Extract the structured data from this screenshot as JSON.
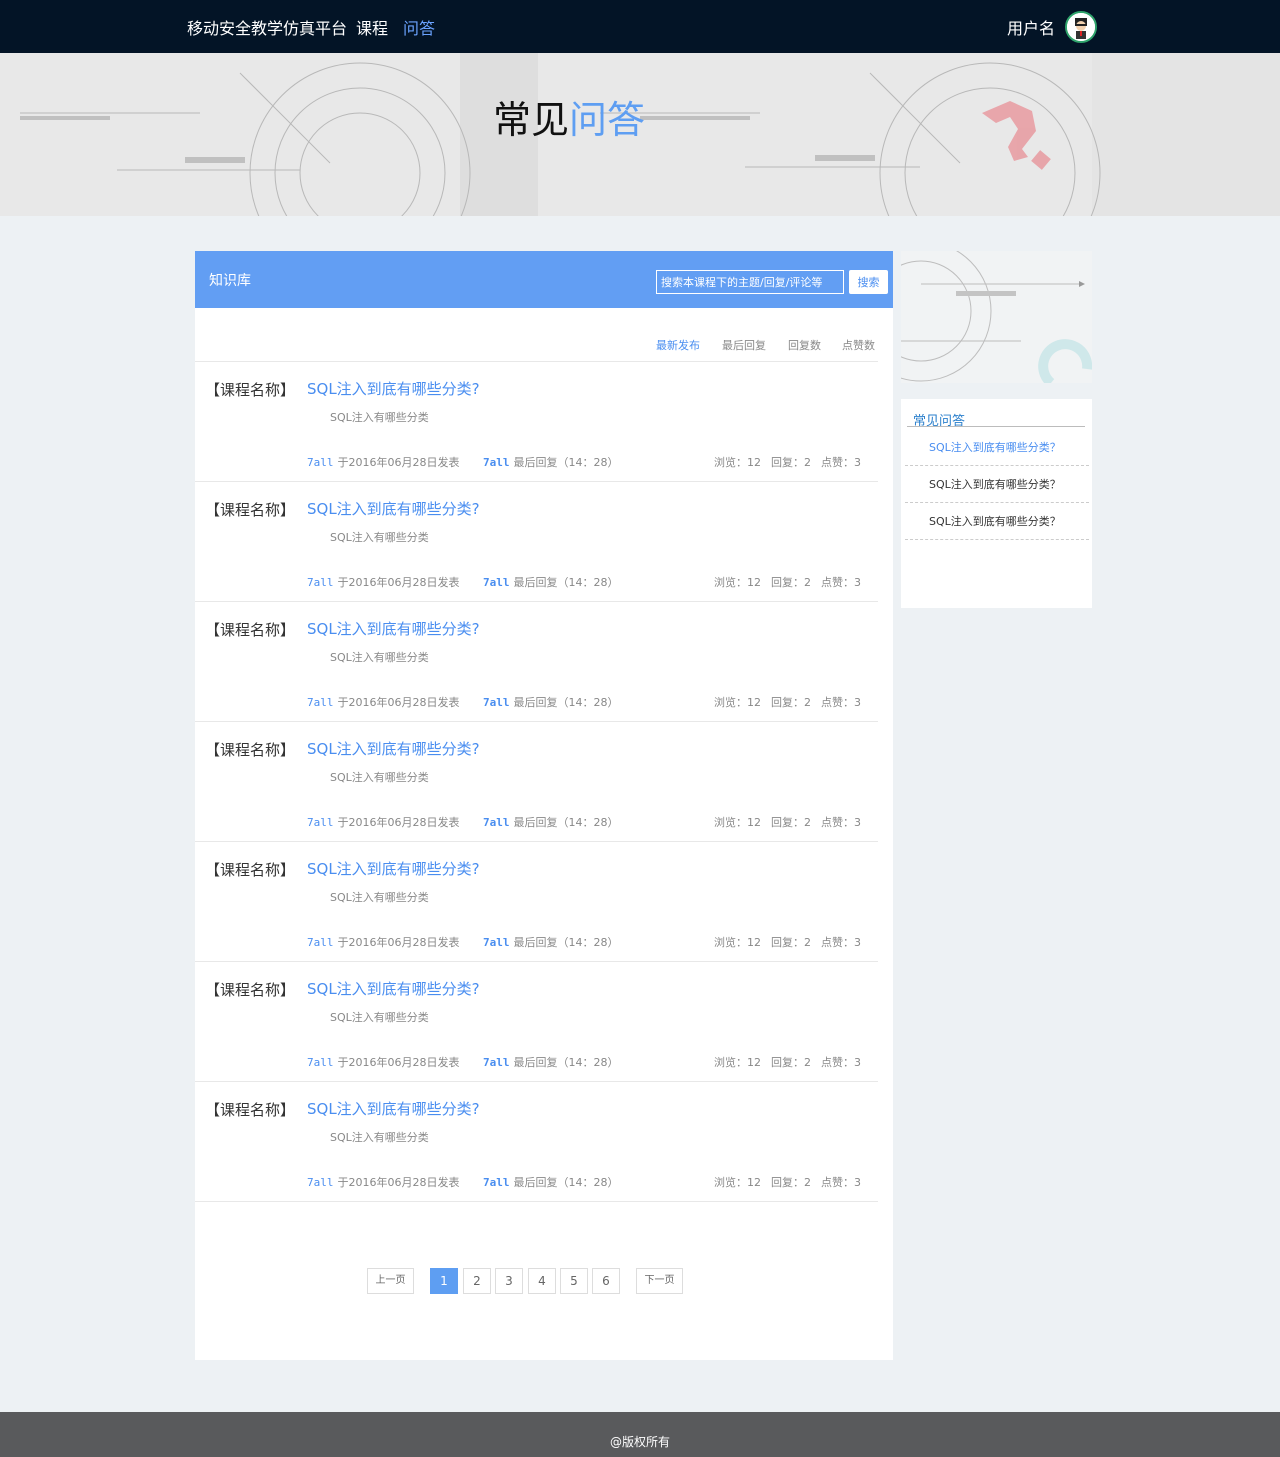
{
  "nav": {
    "brand": "移动安全教学仿真平台",
    "course": "课程",
    "qa": "问答",
    "username": "用户名"
  },
  "banner": {
    "title_part1": "常见",
    "title_part2": "问答"
  },
  "knowledge_base": {
    "title": "知识库",
    "search_placeholder": "搜索本课程下的主题/回复/评论等",
    "search_button": "搜索",
    "sort_options": [
      {
        "label": "最新发布",
        "active": true
      },
      {
        "label": "最后回复",
        "active": false
      },
      {
        "label": "回复数",
        "active": false
      },
      {
        "label": "点赞数",
        "active": false
      }
    ]
  },
  "questions": [
    {
      "course": "【课程名称】",
      "title": "SQL注入到底有哪些分类?",
      "desc": "SQL注入有哪些分类",
      "author": "7all",
      "posted": "于2016年06月28日发表",
      "last_reply_author": "7all",
      "last_reply": "最后回复（14：28）",
      "views": "浏览：12",
      "replies": "回复：2",
      "likes": "点赞：3"
    },
    {
      "course": "【课程名称】",
      "title": "SQL注入到底有哪些分类?",
      "desc": "SQL注入有哪些分类",
      "author": "7all",
      "posted": "于2016年06月28日发表",
      "last_reply_author": "7all",
      "last_reply": "最后回复（14：28）",
      "views": "浏览：12",
      "replies": "回复：2",
      "likes": "点赞：3"
    },
    {
      "course": "【课程名称】",
      "title": "SQL注入到底有哪些分类?",
      "desc": "SQL注入有哪些分类",
      "author": "7all",
      "posted": "于2016年06月28日发表",
      "last_reply_author": "7all",
      "last_reply": "最后回复（14：28）",
      "views": "浏览：12",
      "replies": "回复：2",
      "likes": "点赞：3"
    },
    {
      "course": "【课程名称】",
      "title": "SQL注入到底有哪些分类?",
      "desc": "SQL注入有哪些分类",
      "author": "7all",
      "posted": "于2016年06月28日发表",
      "last_reply_author": "7all",
      "last_reply": "最后回复（14：28）",
      "views": "浏览：12",
      "replies": "回复：2",
      "likes": "点赞：3"
    },
    {
      "course": "【课程名称】",
      "title": "SQL注入到底有哪些分类?",
      "desc": "SQL注入有哪些分类",
      "author": "7all",
      "posted": "于2016年06月28日发表",
      "last_reply_author": "7all",
      "last_reply": "最后回复（14：28）",
      "views": "浏览：12",
      "replies": "回复：2",
      "likes": "点赞：3"
    },
    {
      "course": "【课程名称】",
      "title": "SQL注入到底有哪些分类?",
      "desc": "SQL注入有哪些分类",
      "author": "7all",
      "posted": "于2016年06月28日发表",
      "last_reply_author": "7all",
      "last_reply": "最后回复（14：28）",
      "views": "浏览：12",
      "replies": "回复：2",
      "likes": "点赞：3"
    },
    {
      "course": "【课程名称】",
      "title": "SQL注入到底有哪些分类?",
      "desc": "SQL注入有哪些分类",
      "author": "7all",
      "posted": "于2016年06月28日发表",
      "last_reply_author": "7all",
      "last_reply": "最后回复（14：28）",
      "views": "浏览：12",
      "replies": "回复：2",
      "likes": "点赞：3"
    }
  ],
  "pagination": {
    "prev": "上一页",
    "next": "下一页",
    "pages": [
      "1",
      "2",
      "3",
      "4",
      "5",
      "6"
    ],
    "current": "1"
  },
  "sidebar": {
    "faq_title": "常见问答",
    "faq_items": [
      {
        "label": "SQL注入到底有哪些分类？",
        "active": true
      },
      {
        "label": "SQL注入到底有哪些分类？",
        "active": false
      },
      {
        "label": "SQL注入到底有哪些分类？",
        "active": false
      }
    ]
  },
  "footer": {
    "text": "@版权所有"
  },
  "colors": {
    "nav_bg": "#031426",
    "accent": "#629ef3",
    "link": "#4a8ef0",
    "footer_bg": "#595a5c"
  }
}
